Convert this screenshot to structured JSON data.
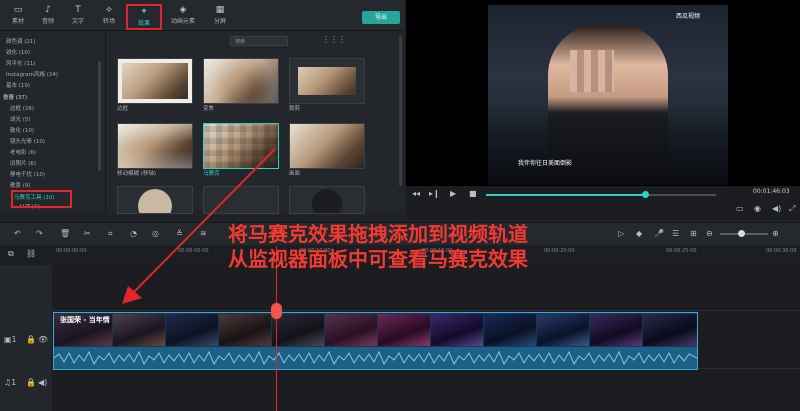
{
  "toolbar": {
    "tabs": [
      {
        "label": "素材",
        "icon": "folder-icon"
      },
      {
        "label": "音频",
        "icon": "music-icon"
      },
      {
        "label": "文字",
        "icon": "text-icon"
      },
      {
        "label": "转场",
        "icon": "transition-icon"
      },
      {
        "label": "效果",
        "icon": "effects-icon"
      },
      {
        "label": "动画元素",
        "icon": "element-icon"
      },
      {
        "label": "分屏",
        "icon": "split-screen-icon"
      }
    ],
    "active_tab": "效果",
    "export_label": "导出"
  },
  "sidebar": {
    "items": [
      {
        "label": "颜色调 (21)"
      },
      {
        "label": "锐化 (10)"
      },
      {
        "label": "风平化 (11)"
      },
      {
        "label": "Instagram风格 (24)"
      },
      {
        "label": "基本 (19)"
      }
    ],
    "group": "叠覆 (37)",
    "subitems": [
      {
        "label": "边框 (26)"
      },
      {
        "label": "滤光 (5)"
      },
      {
        "label": "散化 (10)"
      },
      {
        "label": "镜头光晕 (10)"
      },
      {
        "label": "老电影 (6)"
      },
      {
        "label": "旧照片 (6)"
      },
      {
        "label": "静电干扰 (10)"
      },
      {
        "label": "散景 (9)"
      }
    ],
    "selected": "马赛克工具 (10)",
    "tail": "LUT (1)"
  },
  "effects": {
    "search_placeholder": "搜索",
    "items": [
      {
        "label": "边框"
      },
      {
        "label": "变焦"
      },
      {
        "label": "裁剪"
      },
      {
        "label": "移动模糊 (移轴)"
      },
      {
        "label": "马赛克"
      },
      {
        "label": "画面"
      }
    ]
  },
  "preview": {
    "watermark": "西瓜视频",
    "subtitle": "我伴你往日美面倒影",
    "timecode": "00:01:46:03"
  },
  "timeline": {
    "ticks": [
      "00:00:00:00",
      "00:00:05:00",
      "00:00:10:00",
      "00:00:15:00",
      "00:00:20:00",
      "00:00:25:00",
      "00:00:30:00"
    ],
    "clip_title": "张国荣 - 当年情"
  },
  "annotations": {
    "line1": "将马赛克效果拖拽添加到视频轨道",
    "line2": "从监视器面板中可查看马赛克效果"
  }
}
